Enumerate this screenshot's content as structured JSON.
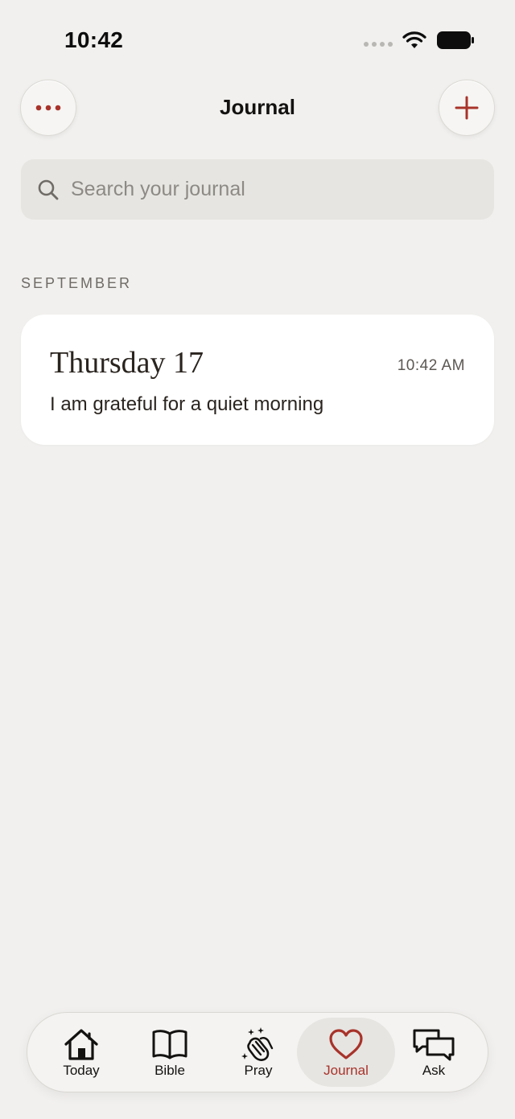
{
  "status_bar": {
    "time": "10:42"
  },
  "header": {
    "title": "Journal"
  },
  "search": {
    "placeholder": "Search your journal"
  },
  "section": {
    "label": "SEPTEMBER"
  },
  "entries": [
    {
      "day": "Thursday 17",
      "time": "10:42 AM",
      "text": "I am grateful for a quiet morning"
    }
  ],
  "tabs": [
    {
      "label": "Today",
      "icon": "home-icon"
    },
    {
      "label": "Bible",
      "icon": "book-icon"
    },
    {
      "label": "Pray",
      "icon": "praying-hands-icon"
    },
    {
      "label": "Journal",
      "icon": "heart-icon",
      "active": true
    },
    {
      "label": "Ask",
      "icon": "chat-bubbles-icon"
    }
  ],
  "colors": {
    "accent": "#a8332a",
    "background": "#f1f0ee",
    "card": "#ffffff",
    "search_bg": "#e6e5e1"
  }
}
